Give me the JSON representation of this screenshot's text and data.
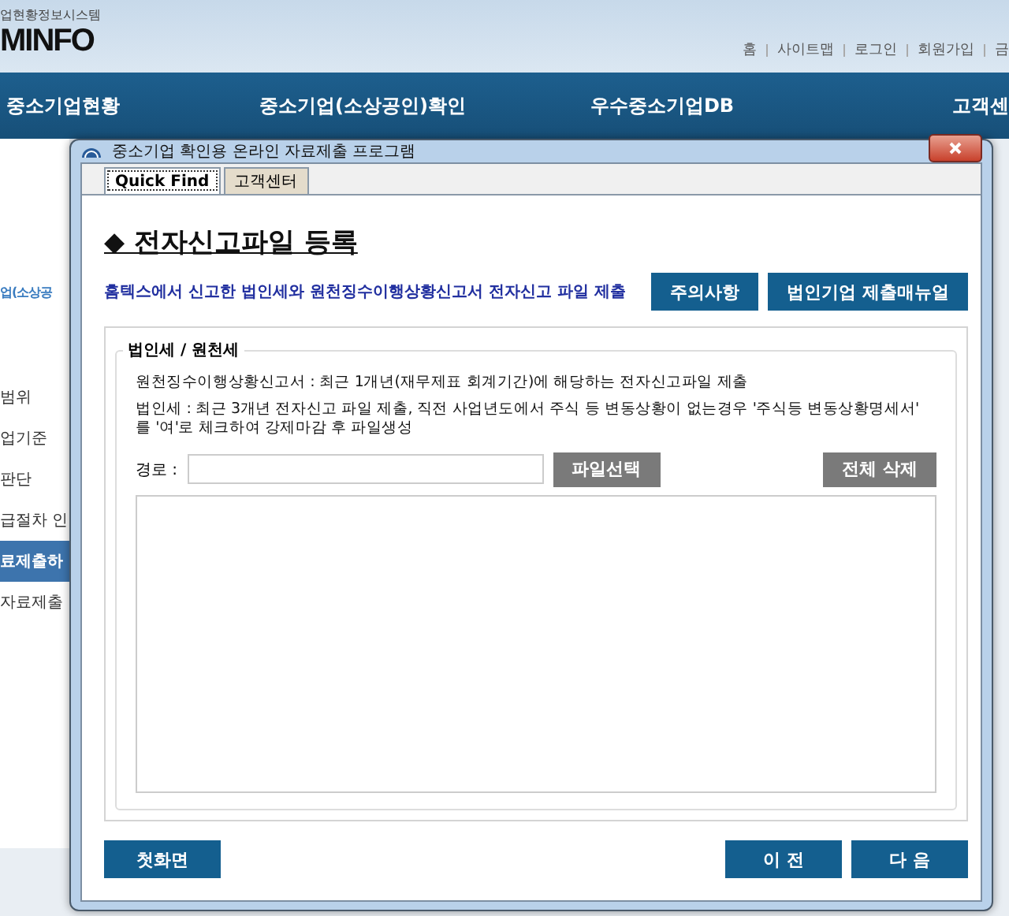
{
  "site": {
    "logo_caption": "업현황정보시스템",
    "logo": "MINFO",
    "top_links": [
      "홈",
      "사이트맵",
      "로그인",
      "회원가입",
      "금"
    ],
    "nav": [
      "중소기업현황",
      "중소기업(소상공인)확인",
      "우수중소기업DB",
      "고객센"
    ],
    "side_heading": "업(소상공",
    "side_items": [
      {
        "label": "범위",
        "selected": false
      },
      {
        "label": "업기준",
        "selected": false
      },
      {
        "label": "판단",
        "selected": false
      },
      {
        "label": "급절차 인",
        "selected": false
      },
      {
        "label": "료제출하",
        "selected": true
      },
      {
        "label": "자료제출",
        "selected": false
      }
    ]
  },
  "dialog": {
    "title": "중소기업 확인용 온라인 자료제출 프로그램",
    "tabs": [
      {
        "label": "Quick Find",
        "selected": true
      },
      {
        "label": "고객센터",
        "selected": false
      }
    ],
    "heading": "◆ 전자신고파일 등록",
    "description": "홈텍스에서 신고한 법인세와 원천징수이행상황신고서 전자신고 파일 제출",
    "top_buttons": [
      "주의사항",
      "법인기업 제출매뉴얼"
    ],
    "group_title": "법인세 / 원천세",
    "notes": [
      "원천징수이행상황신고서 : 최근 1개년(재무제표 회계기간)에 해당하는 전자신고파일 제출",
      "법인세 : 최근 3개년 전자신고 파일 제출, 직전 사업년도에서 주식 등 변동상황이 없는경우 '주식등 변동상황명세서' 를 '여'로 체크하여 강제마감 후 파일생성"
    ],
    "path_label": "경로 :",
    "file_button": "파일선택",
    "clear_button": "전체 삭제",
    "home_button": "첫화면",
    "nav_buttons": [
      "이 전",
      "다 음"
    ]
  }
}
